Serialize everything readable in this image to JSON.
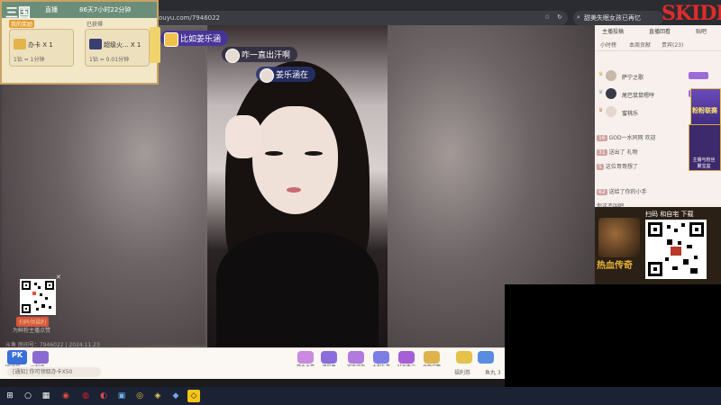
{
  "browser": {
    "address": "ouyu.com/7946022",
    "search_tab": "甜美失眠女孩已再忆",
    "watermark": "SKIDDO"
  },
  "top_left_panel": {
    "logo": "三国",
    "rank_text": "直播",
    "live_duration": "86天7小时22分钟",
    "gift_left": {
      "badge": "我的奖励",
      "name": "办卡 X 1",
      "rate": "1钻 = 1分钟"
    },
    "gift_right": {
      "badge": "已获得",
      "name": "超级火... X 1",
      "rate": "1钻 = 0.01分钟"
    }
  },
  "bubbles": {
    "top": "比如姜乐涵",
    "mid": "咋一直出汗啊",
    "low": "姜乐涵在"
  },
  "qr_left": {
    "caption": "扫码领福利",
    "sub": "为鲜粉主播点赞"
  },
  "room_line": "斗鱼 房间号：7946022 | 2024.11.23",
  "sidebar": {
    "tabs": [
      "主播投稿",
      "直播回看",
      "贴吧"
    ],
    "subtabs": [
      "小时榜",
      "本周贡献",
      "贵宾(23)"
    ],
    "ranks": [
      {
        "name": "萨宁之歌"
      },
      {
        "name": "尾巴鼠鼠嗯哼"
      },
      {
        "name": "蜜桃乐"
      }
    ],
    "chat": [
      {
        "lv": "16",
        "text": "GOD一水同网 欢迎"
      },
      {
        "lv": "31",
        "text": "送出了 礼物"
      },
      {
        "lv": "5",
        "text": "这位哥哥想了"
      },
      {
        "lv": "62",
        "text": "送给了你的小手"
      },
      {
        "lv": "",
        "text": "你这不叫吧"
      }
    ],
    "event_banner": "粉粉联赛",
    "event_banner_2": "主播与粉丝 聚宝盆"
  },
  "game_ad": {
    "title": "扫码 和自宅 下载",
    "logo": "热血传奇"
  },
  "gift_bar": {
    "pk_badge": "PK",
    "pk_label": "PK活动",
    "item2_label": "一起读",
    "items": [
      {
        "label": "药水大富",
        "color": "#c98ae0"
      },
      {
        "label": "流星雨",
        "color": "#8b6ed9"
      },
      {
        "label": "宇宙戒指",
        "color": "#b07adf"
      },
      {
        "label": "大型礼盒",
        "color": "#7d7de6"
      },
      {
        "label": "钻石告白",
        "color": "#a65fd6"
      },
      {
        "label": "全能宝箱",
        "color": "#e0b24d"
      },
      {
        "label": "",
        "color": "#e5c34a"
      },
      {
        "label": "",
        "color": "#5a8de0"
      }
    ],
    "chat_placeholder": "[通知] 你可领取办卡X50",
    "welfare": "福利券",
    "fish_ball": "鱼丸 3"
  },
  "taskbar": {
    "icons": [
      "⊞",
      "○",
      "▦",
      "◉",
      "◍",
      "◐",
      "▣",
      "◎",
      "◈",
      "◆",
      "◇"
    ]
  },
  "colors": {
    "sidebar_bg": "#f7f0ec",
    "panel_gold": "#c9a262",
    "bubble_purple": "#4632a0"
  }
}
